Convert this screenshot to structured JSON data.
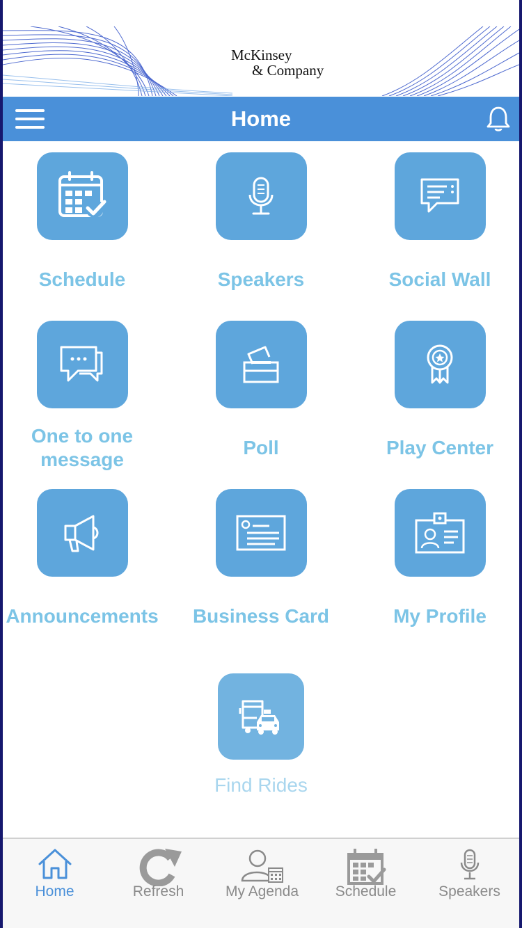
{
  "banner": {
    "logo_line1": "McKinsey",
    "logo_line2": "& Company"
  },
  "header": {
    "title": "Home",
    "menu_icon": "hamburger-menu-icon",
    "notification_icon": "bell-icon"
  },
  "grid": {
    "items": [
      {
        "label": "Schedule",
        "icon": "calendar-check-icon"
      },
      {
        "label": "Speakers",
        "icon": "microphone-icon"
      },
      {
        "label": "Social Wall",
        "icon": "chat-bubble-icon"
      },
      {
        "label": "One to one",
        "label2": "message",
        "icon": "chat-bubbles-icon"
      },
      {
        "label": "Poll",
        "icon": "ballot-box-icon"
      },
      {
        "label": "Play Center",
        "icon": "award-ribbon-icon"
      },
      {
        "label": "Announcements",
        "icon": "megaphone-icon"
      },
      {
        "label": "Business Card",
        "icon": "business-card-icon"
      },
      {
        "label": "My Profile",
        "icon": "id-badge-icon"
      },
      {
        "label": "Find Rides",
        "icon": "bus-taxi-icon"
      }
    ]
  },
  "tabbar": {
    "tabs": [
      {
        "label": "Home",
        "icon": "home-icon",
        "active": true
      },
      {
        "label": "Refresh",
        "icon": "refresh-icon"
      },
      {
        "label": "My Agenda",
        "icon": "person-calendar-icon"
      },
      {
        "label": "Schedule",
        "icon": "calendar-check-icon"
      },
      {
        "label": "Speakers",
        "icon": "microphone-icon"
      }
    ]
  },
  "colors": {
    "header_bg": "#4a90d9",
    "tile_bg": "#5ea6dc",
    "tile_label": "#7cc4e6",
    "tab_active": "#4a90d9",
    "tab_inactive": "#8a8a8a"
  }
}
